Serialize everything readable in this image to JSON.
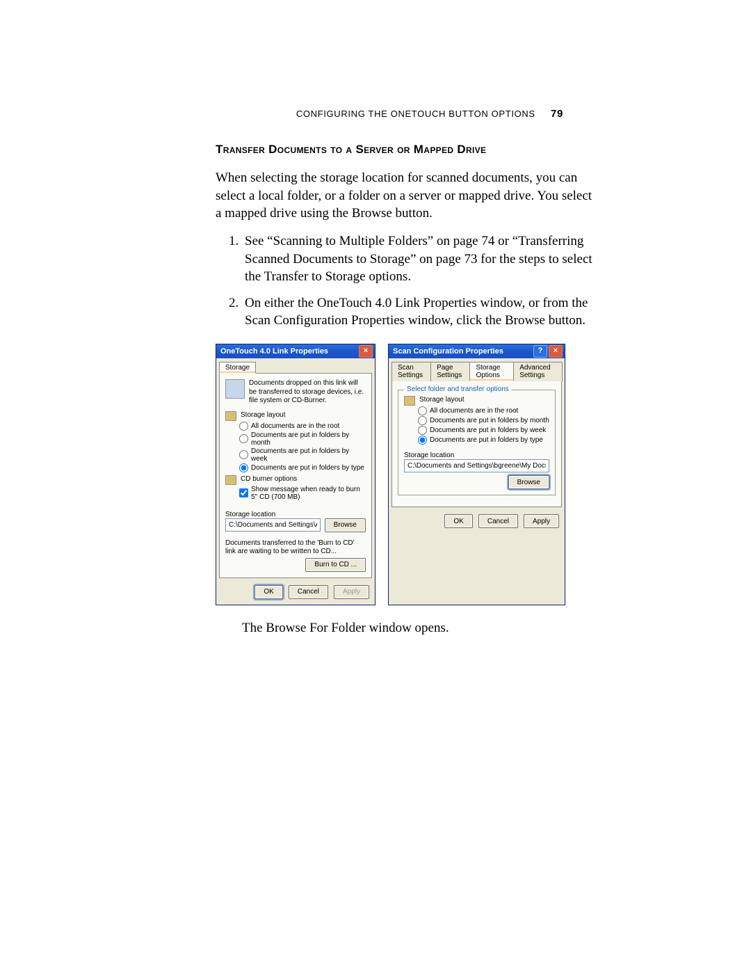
{
  "header": {
    "running": "CONFIGURING THE ONETOUCH BUTTON OPTIONS",
    "page_number": "79"
  },
  "section_title": "Transfer Documents to a Server or Mapped Drive",
  "intro_paragraph": "When selecting the storage location for scanned documents, you can select a local folder, or a folder on a server or mapped drive. You select a mapped drive using the Browse button.",
  "steps": [
    "See “Scanning to Multiple Folders” on page 74 or “Transferring Scanned Documents to Storage” on page 73 for the steps to select the Transfer to Storage options.",
    "On either the OneTouch 4.0 Link Properties window, or from the Scan Configuration Properties window, click the Browse button."
  ],
  "after_figure": "The Browse For Folder window opens.",
  "left_dialog": {
    "title": "OneTouch 4.0 Link Properties",
    "tab_storage": "Storage",
    "description": "Documents dropped on this link will be transferred to storage devices, i.e. file system or CD-Burner.",
    "layout_label": "Storage layout",
    "layout_options": {
      "root": "All documents are in the root",
      "month": "Documents are put in folders by month",
      "week": "Documents are put in folders by week",
      "type": "Documents are put in folders by type"
    },
    "cd_label": "CD burner options",
    "cd_option": "Show message when ready to burn 5'' CD (700 MB)",
    "location_label": "Storage location",
    "location_value": "C:\\Documents and Settings\\Administrator\\My Do",
    "browse": "Browse",
    "burn_note": "Documents transferred to the 'Burn to CD' link are waiting to be written to CD...",
    "burn_btn": "Burn to CD ...",
    "ok": "OK",
    "cancel": "Cancel",
    "apply": "Apply"
  },
  "right_dialog": {
    "title": "Scan Configuration Properties",
    "tabs": {
      "scan": "Scan Settings",
      "page": "Page Settings",
      "storage": "Storage Options",
      "advanced": "Advanced Settings"
    },
    "group_legend": "Select folder and transfer options",
    "layout_label": "Storage layout",
    "layout_options": {
      "root": "All documents are in the root",
      "month": "Documents are put in folders by month",
      "week": "Documents are put in folders by week",
      "type": "Documents are put in folders by type"
    },
    "location_label": "Storage location",
    "location_value": "C:\\Documents and Settings\\bgreene\\My Documents\\My OneTou",
    "browse": "Browse",
    "ok": "OK",
    "cancel": "Cancel",
    "apply": "Apply"
  }
}
